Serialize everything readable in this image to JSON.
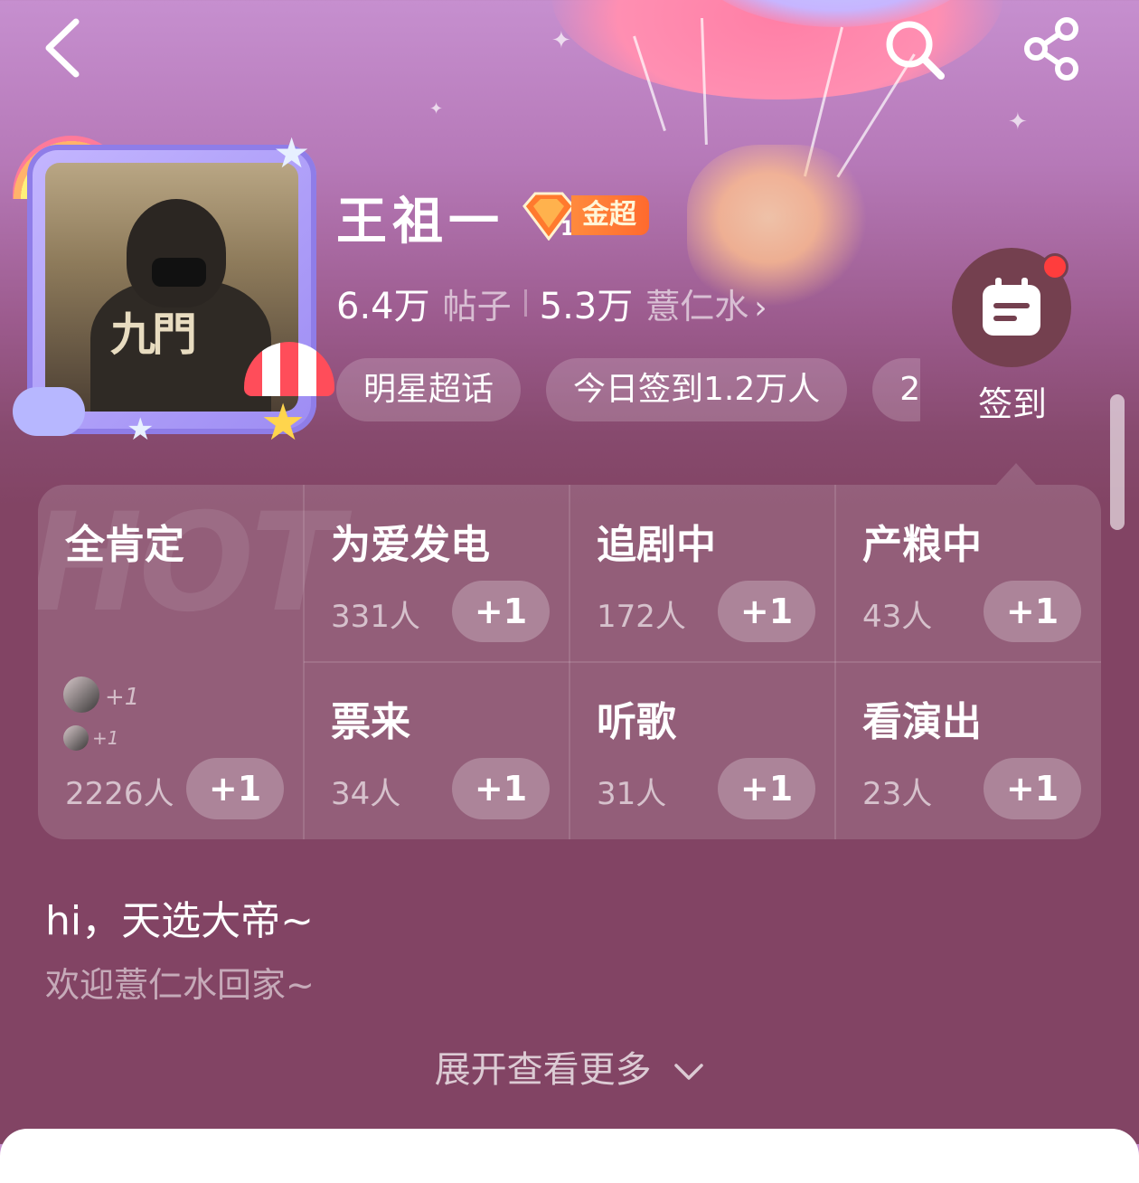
{
  "header": {
    "back_icon": "chevron-left-icon",
    "search_icon": "search-icon",
    "share_icon": "share-icon"
  },
  "profile": {
    "name": "王祖一",
    "badge_level": "1",
    "badge_label": "金超",
    "avatar_poster_title": "九門",
    "stats": {
      "posts_count": "6.4万",
      "posts_unit": "帖子",
      "fans_count": "5.3万",
      "fans_name": "薏仁水",
      "chevron": "›"
    },
    "tags": [
      "明星超话",
      "今日签到1.2万人",
      "2"
    ]
  },
  "checkin": {
    "label": "签到",
    "has_notification_dot": true,
    "icon": "calendar-icon"
  },
  "reactions": {
    "watermark": "HOT",
    "plus_label": "+1",
    "items": [
      {
        "title": "全肯定",
        "count": "2226人"
      },
      {
        "title": "为爱发电",
        "count": "331人"
      },
      {
        "title": "追剧中",
        "count": "172人"
      },
      {
        "title": "产粮中",
        "count": "43人"
      },
      {
        "title": "票来",
        "count": "34人"
      },
      {
        "title": "听歌",
        "count": "31人"
      },
      {
        "title": "看演出",
        "count": "23人"
      }
    ],
    "recent_plus": [
      "+1",
      "+1"
    ]
  },
  "greeting": {
    "title": "hi，天选大帝~",
    "subtitle": "欢迎薏仁水回家~",
    "expand_label": "展开查看更多"
  },
  "colors": {
    "background_top": "#c68fcf",
    "background_main": "#824464",
    "badge_orange": "#ff6a2e",
    "notification_red": "#ff3d3d"
  }
}
